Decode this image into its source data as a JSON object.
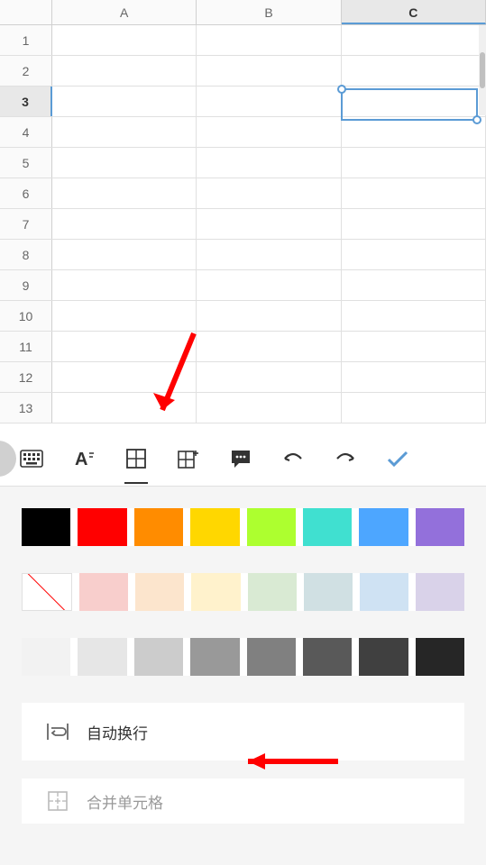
{
  "columns": [
    "A",
    "B",
    "C"
  ],
  "rows": [
    "1",
    "2",
    "3",
    "4",
    "5",
    "6",
    "7",
    "8",
    "9",
    "10",
    "11",
    "12",
    "13"
  ],
  "selected_column_index": 2,
  "selected_row_index": 2,
  "colors_row1": [
    "#000000",
    "#ff0000",
    "#ff8c00",
    "#ffd700",
    "#adff2f",
    "#40e0d0",
    "#4da6ff",
    "#9370db"
  ],
  "colors_row2_light": [
    "nofill",
    "#f8cecc",
    "#fce5cd",
    "#fff2cc",
    "#d9ead3",
    "#d0e0e3",
    "#cfe2f3",
    "#d9d2e9"
  ],
  "colors_row3_gray": [
    "#f2f2f2",
    "#e6e6e6",
    "#cccccc",
    "#999999",
    "#808080",
    "#595959",
    "#404040",
    "#262626"
  ],
  "options": {
    "wrap_text": "自动换行",
    "merge_cells": "合并单元格"
  }
}
